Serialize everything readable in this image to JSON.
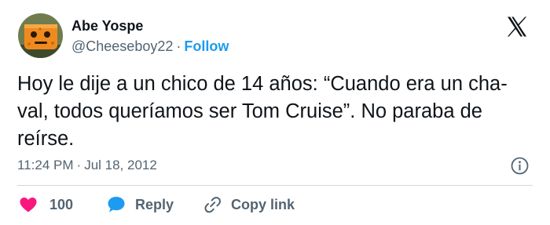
{
  "user": {
    "display_name": "Abe Yospe",
    "handle": "@Cheeseboy22",
    "separator": "·",
    "follow_label": "Follow"
  },
  "tweet": {
    "lines": [
      "Hoy le dije a un chico de 14 años: “Cuando era un cha-",
      "val, todos queríamos ser Tom Cruise”. No paraba de",
      "reírse."
    ],
    "time": "11:24 PM",
    "date_separator": "·",
    "date": "Jul 18, 2012"
  },
  "actions": {
    "like_count": "100",
    "reply_label": "Reply",
    "copy_link_label": "Copy link"
  },
  "icons": {
    "brand": "x-logo-icon",
    "info": "info-icon",
    "like": "heart-icon",
    "reply": "speech-bubble-icon",
    "copy": "link-icon"
  },
  "colors": {
    "text": "#0f1419",
    "secondary": "#536471",
    "accent": "#1d9bf0",
    "like": "#f91880",
    "divider": "#cfd9de"
  }
}
